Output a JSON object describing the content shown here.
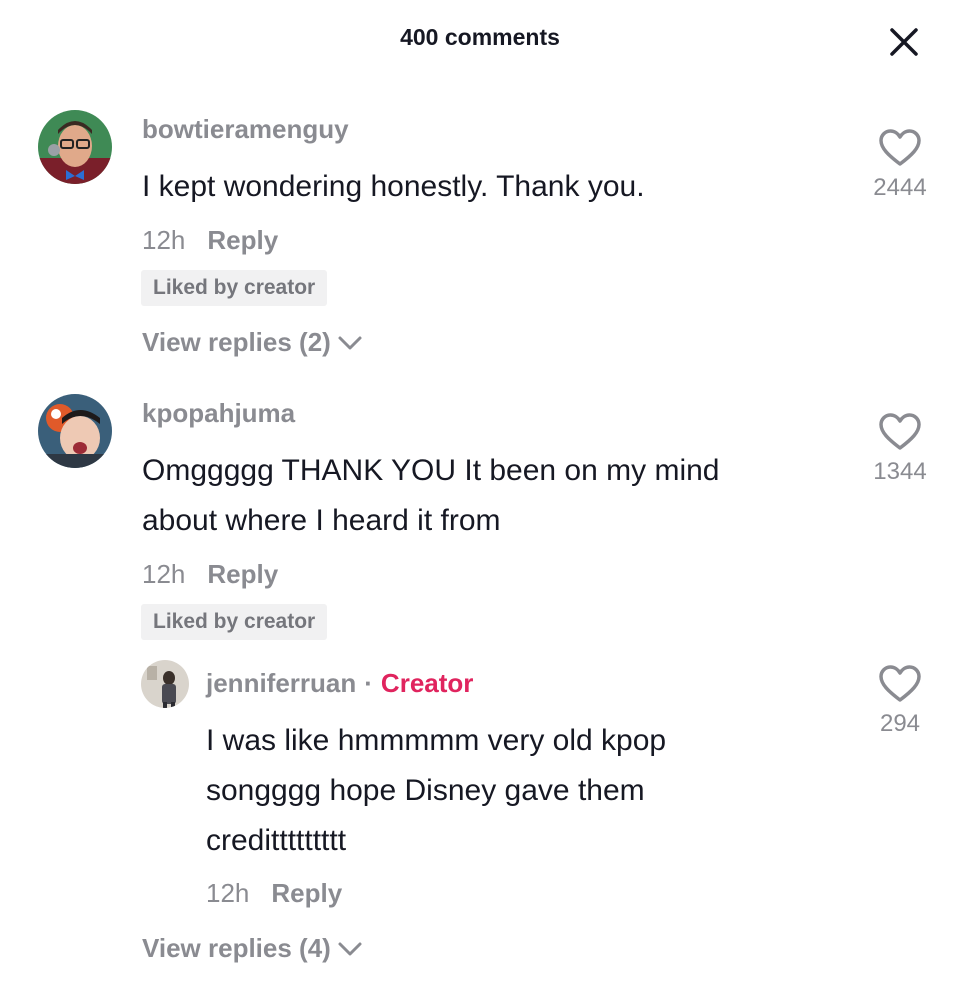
{
  "header": {
    "title": "400 comments",
    "close_icon": "close-icon"
  },
  "comments": [
    {
      "username": "bowtieramenguy",
      "text_lines": [
        "I kept wondering honestly. Thank you."
      ],
      "time": "12h",
      "reply_label": "Reply",
      "liked_badge": "Liked by creator",
      "likes": "2444",
      "view_replies": "View replies (2)"
    },
    {
      "username": "kpopahjuma",
      "text_lines": [
        "Omggggg THANK YOU It been on my mind",
        "about where I heard it from"
      ],
      "time": "12h",
      "reply_label": "Reply",
      "liked_badge": "Liked by creator",
      "likes": "1344",
      "view_replies": "View replies (4)"
    }
  ],
  "reply": {
    "username": "jenniferruan",
    "separator": "·",
    "creator_label": "Creator",
    "text_lines": [
      "I was like hmmmmm very old kpop",
      "songggg hope Disney gave them",
      "credittttttttt"
    ],
    "time": "12h",
    "reply_label": "Reply",
    "likes": "294"
  },
  "colors": {
    "creator": "#e0245e",
    "secondary_text": "#8a8b91",
    "badge_bg": "#f1f1f2"
  }
}
